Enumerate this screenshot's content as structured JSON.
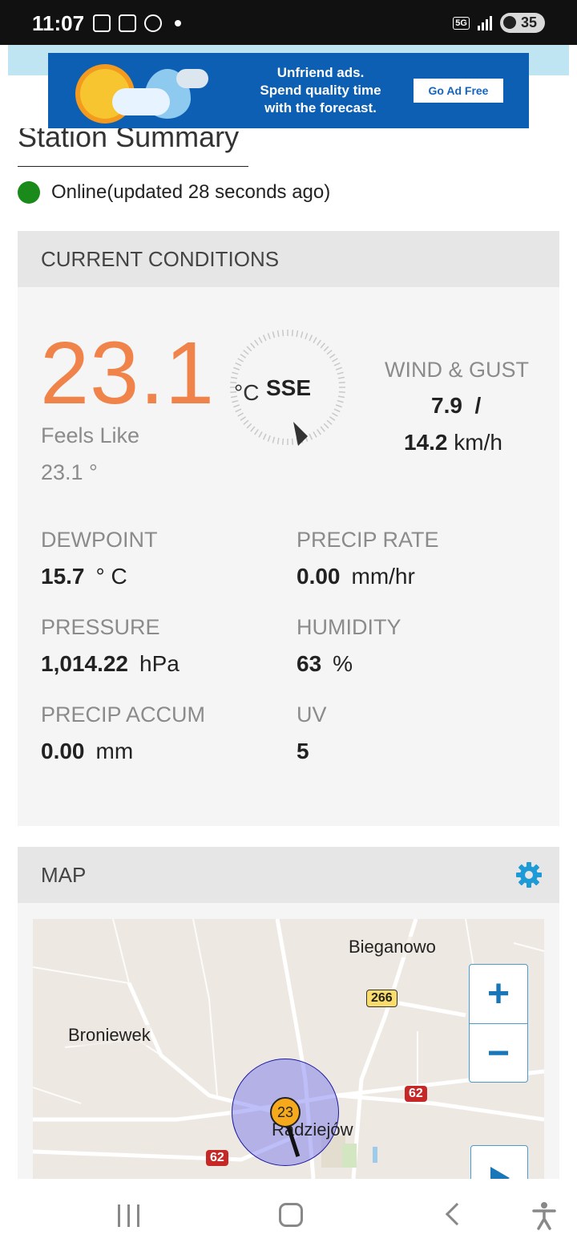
{
  "status_bar": {
    "time": "11:07",
    "network": "5G",
    "battery": "35"
  },
  "ad": {
    "line1": "Unfriend ads.",
    "line2": "Spend quality time",
    "line3": "with the forecast.",
    "button": "Go Ad Free"
  },
  "page": {
    "title": "Station Summary",
    "status": "Online(updated 28 seconds ago)",
    "status_color": "#1a8a1a"
  },
  "conditions": {
    "header": "CURRENT CONDITIONS",
    "temperature": "23.1",
    "temperature_color": "#f0834a",
    "unit": "°C",
    "feels_like_label": "Feels Like",
    "feels_like_value": "23.1 °",
    "wind_direction": "SSE",
    "wind_label": "WIND & GUST",
    "wind_value": "7.9",
    "wind_separator": "/",
    "gust_value": "14.2",
    "wind_unit": "km/h",
    "metrics": [
      {
        "label": "DEWPOINT",
        "value": "15.7",
        "unit": "° C"
      },
      {
        "label": "PRECIP RATE",
        "value": "0.00",
        "unit": "mm/hr"
      },
      {
        "label": "PRESSURE",
        "value": "1,014.22",
        "unit": "hPa"
      },
      {
        "label": "HUMIDITY",
        "value": "63",
        "unit": "%"
      },
      {
        "label": "PRECIP ACCUM",
        "value": "0.00",
        "unit": "mm"
      },
      {
        "label": "UV",
        "value": "5",
        "unit": ""
      }
    ]
  },
  "map": {
    "header": "MAP",
    "settings_icon": "gear-icon",
    "labels": {
      "bieganowo": "Bieganowo",
      "broniewek": "Broniewek",
      "radziejow": "Radziejów"
    },
    "roads": {
      "r266": "266",
      "r62a": "62",
      "r62b": "62"
    },
    "marker_value": "23",
    "zoom_in": "+",
    "zoom_out": "−"
  }
}
